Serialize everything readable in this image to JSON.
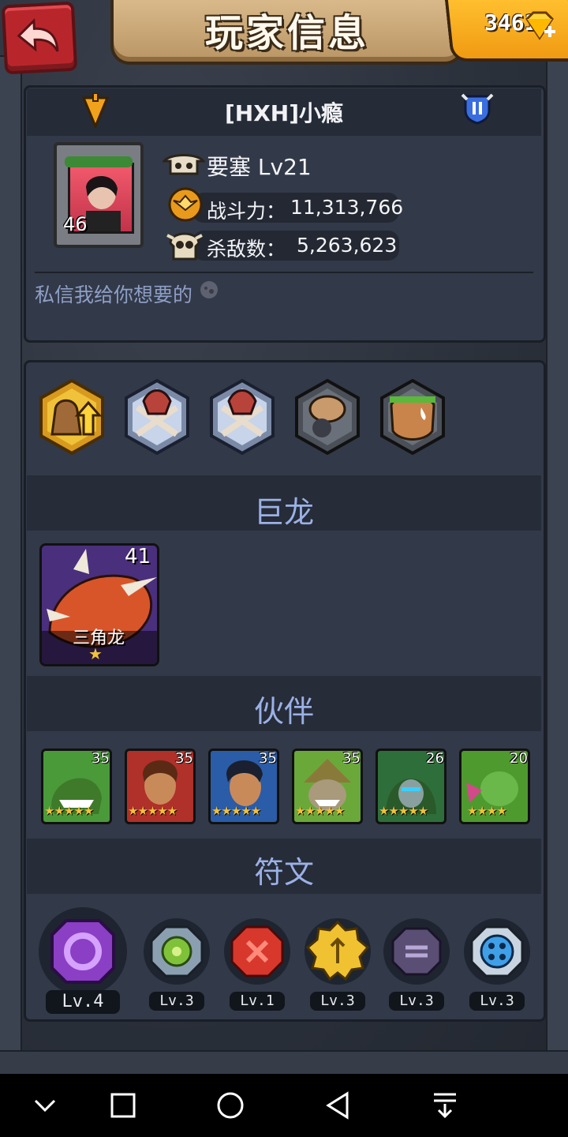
{
  "header": {
    "title": "玩家信息",
    "gem_count": "3461",
    "colors": {
      "back_button": "#b8262c",
      "title_plate": "#d9b98a",
      "gem_plate": "#f7ad1f"
    }
  },
  "player": {
    "name": "[HXH]小瘾",
    "avatar_level": "46",
    "fortress": "要塞 Lv21",
    "power_label": "战斗力：",
    "power_value": "11,313,766",
    "kills_label": "杀敌数：",
    "kills_value": "5,263,623",
    "signature": "私信我给你想要的"
  },
  "badges": [
    {
      "icon": "upgrade-sack-badge-icon"
    },
    {
      "icon": "axe-bones-badge-icon"
    },
    {
      "icon": "axe-bones-badge-icon"
    },
    {
      "icon": "dwarf-badge-icon"
    },
    {
      "icon": "orc-face-badge-icon"
    }
  ],
  "sections": {
    "dragon": "巨龙",
    "companions": "伙伴",
    "runes": "符文"
  },
  "dragon": {
    "name": "三角龙",
    "level": "41",
    "stars": "★"
  },
  "companions": [
    {
      "level": "35",
      "stars": "★★★★★",
      "color": "#4a9a3a"
    },
    {
      "level": "35",
      "stars": "★★★★★",
      "color": "#b0302a"
    },
    {
      "level": "35",
      "stars": "★★★★★",
      "color": "#2a5ca8"
    },
    {
      "level": "35",
      "stars": "★★★★★",
      "color": "#6aa83a"
    },
    {
      "level": "26",
      "stars": "★★★★★",
      "color": "#2e6e3a"
    },
    {
      "level": "20",
      "stars": "★★★★",
      "color": "#4e9a2e"
    }
  ],
  "runes": [
    {
      "level": "Lv.4",
      "color": "#8a3fc4"
    },
    {
      "level": "Lv.3",
      "color": "#7fc23a"
    },
    {
      "level": "Lv.1",
      "color": "#d8382c"
    },
    {
      "level": "Lv.3",
      "color": "#f0c232"
    },
    {
      "level": "Lv.3",
      "color": "#5a4e74"
    },
    {
      "level": "Lv.3",
      "color": "#3fa0e8"
    }
  ]
}
